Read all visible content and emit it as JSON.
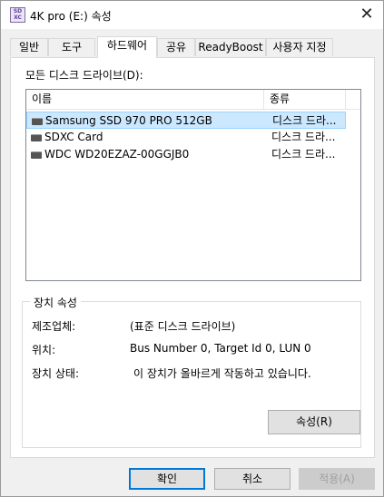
{
  "window": {
    "title": "4K pro (E:) 속성",
    "icon_text": "SD XC"
  },
  "tabs": [
    {
      "label": "일반"
    },
    {
      "label": "도구"
    },
    {
      "label": "하드웨어",
      "active": true
    },
    {
      "label": "공유"
    },
    {
      "label": "ReadyBoost"
    },
    {
      "label": "사용자 지정"
    }
  ],
  "drives": {
    "label": "모든 디스크 드라이브(D):",
    "columns": [
      "이름",
      "종류"
    ],
    "rows": [
      {
        "name": "Samsung SSD 970 PRO 512GB",
        "type": "디스크 드라...",
        "selected": true
      },
      {
        "name": "SDXC Card",
        "type": "디스크 드라..."
      },
      {
        "name": "WDC WD20EZAZ-00GGJB0",
        "type": "디스크 드라..."
      }
    ]
  },
  "properties": {
    "title": "장치 속성",
    "manufacturer_label": "제조업체:",
    "manufacturer_value": "(표준 디스크 드라이브)",
    "location_label": "위치:",
    "location_value": "Bus Number 0, Target Id 0, LUN 0",
    "status_label": "장치 상태:",
    "status_value": "이 장치가 올바르게 작동하고 있습니다.",
    "properties_button": "속성(R)"
  },
  "footer": {
    "ok": "확인",
    "cancel": "취소",
    "apply": "적용(A)"
  },
  "colors": {
    "selection": "#cce8ff",
    "accent": "#0078d7"
  }
}
